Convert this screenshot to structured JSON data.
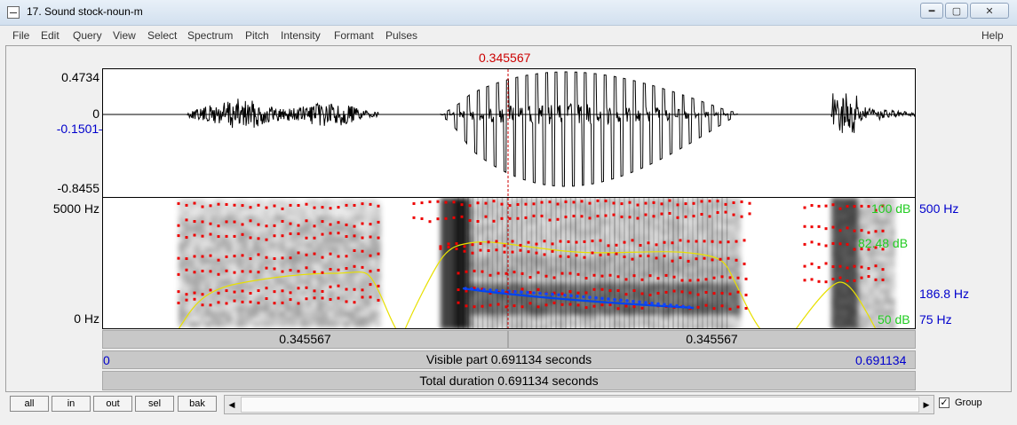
{
  "window": {
    "title": "17. Sound stock-noun-m",
    "buttons": [
      "minimize",
      "maximize",
      "close"
    ]
  },
  "menu": {
    "items": [
      "File",
      "Edit",
      "Query",
      "View",
      "Select",
      "Spectrum",
      "Pitch",
      "Intensity",
      "Formant",
      "Pulses"
    ],
    "help": "Help"
  },
  "cursor": {
    "time": "0.345567"
  },
  "waveform": {
    "y_max": "0.4734",
    "y_zero": "0",
    "y_cursor": "-0.1501",
    "y_min": "-0.8455"
  },
  "spectrogram": {
    "freq_top": "5000 Hz",
    "freq_bottom": "0 Hz",
    "intensity_top": "100 dB",
    "intensity_mid": "82.48 dB",
    "intensity_bottom": "50 dB",
    "pitch_top": "500 Hz",
    "pitch_cursor": "186.8 Hz",
    "pitch_bottom": "75 Hz"
  },
  "time_bars": {
    "left_segment": "0.345567",
    "right_segment": "0.345567",
    "visible_start": "0",
    "visible_label": "Visible part 0.691134 seconds",
    "visible_end": "0.691134",
    "total_label": "Total duration 0.691134 seconds"
  },
  "controls": {
    "zoom_buttons": [
      "all",
      "in",
      "out",
      "sel",
      "bak"
    ],
    "group_label": "Group",
    "group_checked": true
  },
  "colors": {
    "cursor": "#cc0000",
    "blue_label": "#0000cc",
    "green_label": "#22cc22",
    "formant_dots": "#ee0000",
    "intensity_line": "#e8e000",
    "pitch_line": "#0044ee"
  }
}
